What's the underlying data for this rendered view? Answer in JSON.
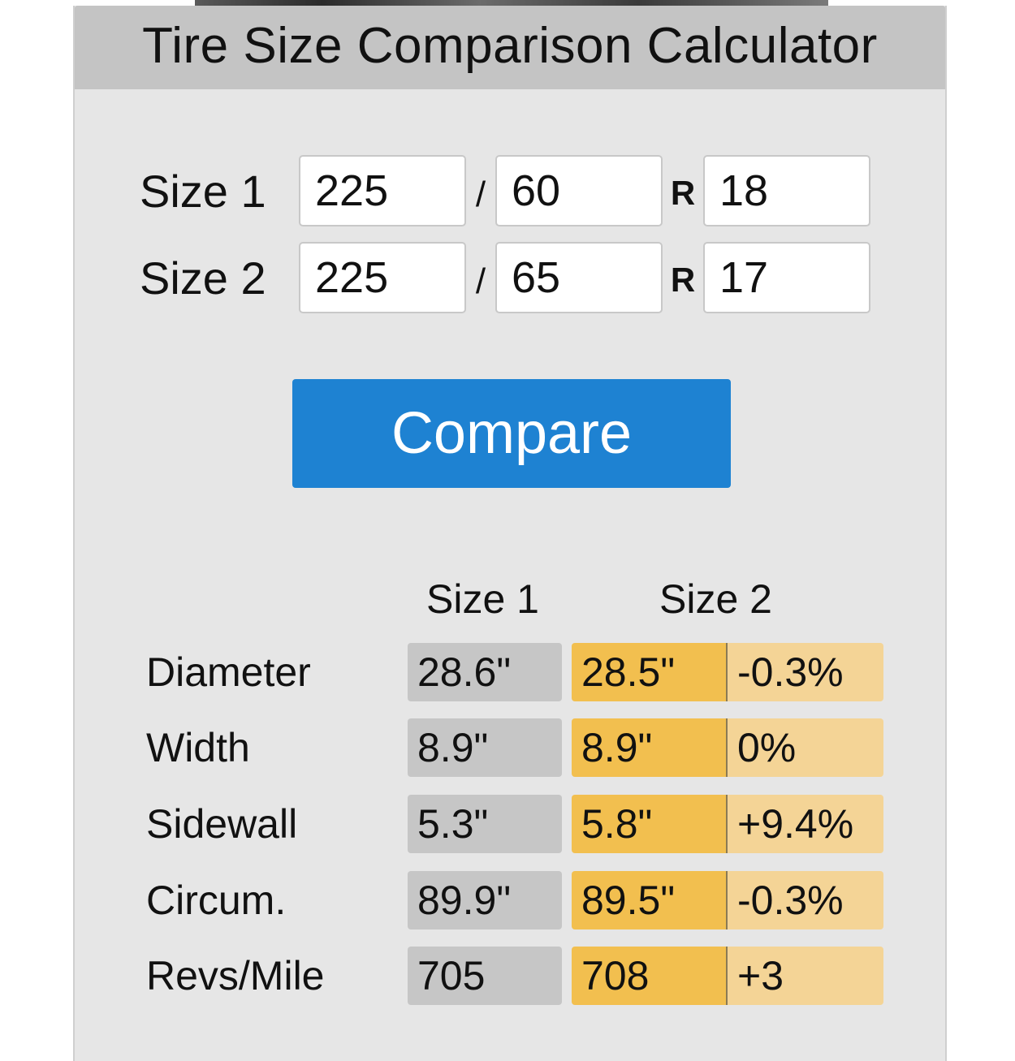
{
  "header": {
    "title": "Tire Size Comparison Calculator"
  },
  "inputs": {
    "size1": {
      "label": "Size 1",
      "width": "225",
      "aspect": "60",
      "rim": "18"
    },
    "size2": {
      "label": "Size 2",
      "width": "225",
      "aspect": "65",
      "rim": "17"
    },
    "slash": "/",
    "radial": "R"
  },
  "compare_button": {
    "label": "Compare",
    "color": "#1e82d2"
  },
  "results": {
    "col_size1": "Size 1",
    "col_size2": "Size 2",
    "rows": [
      {
        "label": "Diameter",
        "size1": "28.6\"",
        "size2": "28.5\"",
        "diff": "-0.3%"
      },
      {
        "label": "Width",
        "size1": "8.9\"",
        "size2": "8.9\"",
        "diff": "0%"
      },
      {
        "label": "Sidewall",
        "size1": "5.3\"",
        "size2": "5.8\"",
        "diff": "+9.4%"
      },
      {
        "label": "Circum.",
        "size1": "89.9\"",
        "size2": "89.5\"",
        "diff": "-0.3%"
      },
      {
        "label": "Revs/Mile",
        "size1": "705",
        "size2": "708",
        "diff": "+3"
      }
    ]
  },
  "colors": {
    "header_bg": "#c4c4c4",
    "panel_bg": "#e6e6e6",
    "size1_cell": "#c6c6c6",
    "size2_cell": "#f2bf4f",
    "diff_cell": "#f4d496"
  }
}
